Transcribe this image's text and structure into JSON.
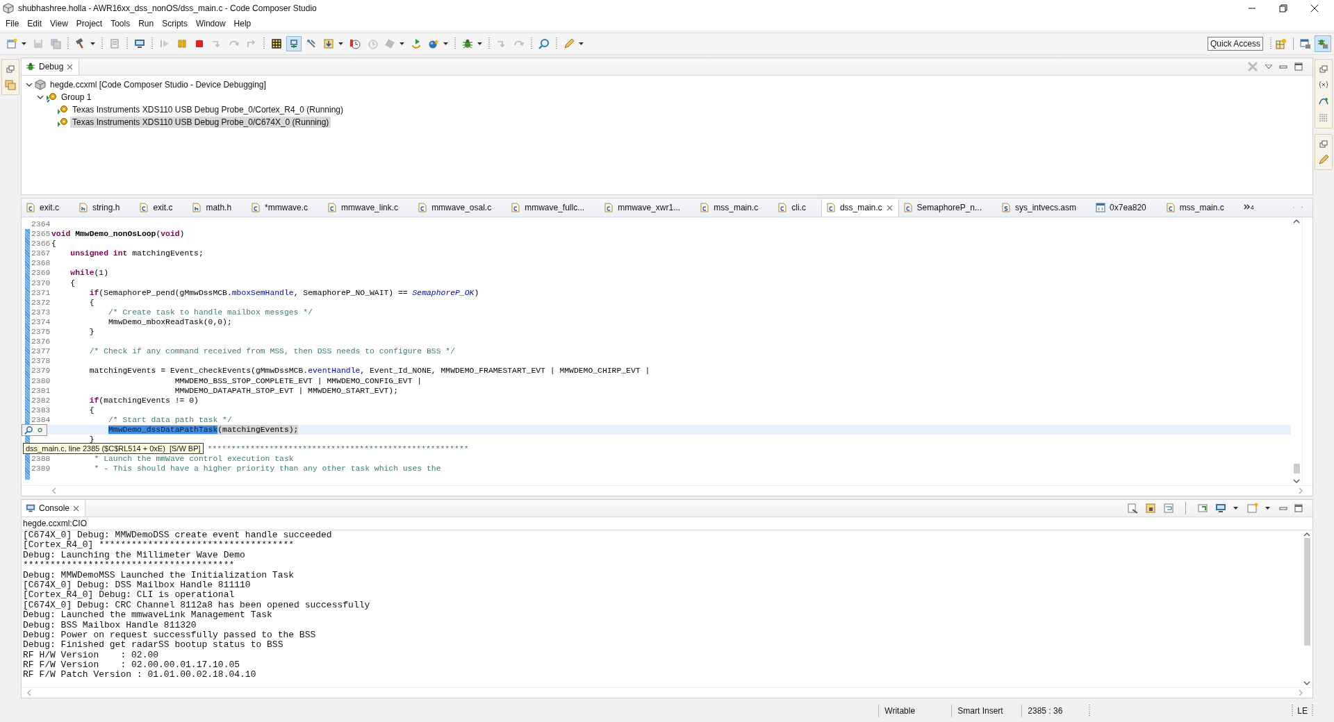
{
  "window": {
    "title": "shubhashree.holla - AWR16xx_dss_nonOS/dss_main.c - Code Composer Studio"
  },
  "menu": [
    "File",
    "Edit",
    "View",
    "Project",
    "Tools",
    "Run",
    "Scripts",
    "Window",
    "Help"
  ],
  "toolbar": {
    "quick_access": "Quick Access"
  },
  "debug_view": {
    "tab": "Debug",
    "tree": [
      {
        "label": "hegde.ccxml [Code Composer Studio - Device Debugging]",
        "kind": "config",
        "expanded": true,
        "selected": false,
        "children": [
          {
            "label": "Group 1",
            "kind": "group",
            "expanded": true,
            "selected": false,
            "children": [
              {
                "label": "Texas Instruments XDS110 USB Debug Probe_0/Cortex_R4_0 (Running)",
                "kind": "core",
                "selected": false
              },
              {
                "label": "Texas Instruments XDS110 USB Debug Probe_0/C674X_0 (Running)",
                "kind": "core",
                "selected": true
              }
            ]
          }
        ]
      }
    ]
  },
  "editor": {
    "tabs": [
      {
        "label": "exit.c",
        "kind": "source",
        "selected": false
      },
      {
        "label": "string.h",
        "kind": "header",
        "selected": false
      },
      {
        "label": "exit.c",
        "kind": "source",
        "selected": false
      },
      {
        "label": "math.h",
        "kind": "header",
        "selected": false
      },
      {
        "label": "*mmwave.c",
        "kind": "source",
        "selected": false
      },
      {
        "label": "mmwave_link.c",
        "kind": "source",
        "selected": false
      },
      {
        "label": "mmwave_osal.c",
        "kind": "source",
        "selected": false
      },
      {
        "label": "mmwave_fullc...",
        "kind": "source",
        "selected": false
      },
      {
        "label": "mmwave_xwr1...",
        "kind": "source",
        "selected": false
      },
      {
        "label": "mss_main.c",
        "kind": "source",
        "selected": false
      },
      {
        "label": "cli.c",
        "kind": "source",
        "selected": false
      },
      {
        "label": "dss_main.c",
        "kind": "source",
        "selected": true
      },
      {
        "label": "SemaphoreP_n...",
        "kind": "source",
        "selected": false
      },
      {
        "label": "sys_intvecs.asm",
        "kind": "assembly",
        "selected": false
      },
      {
        "label": "0x7ea820",
        "kind": "disassembly",
        "selected": false
      },
      {
        "label": "mss_main.c",
        "kind": "source",
        "selected": false
      }
    ],
    "overflow_count": "4",
    "lines": [
      {
        "number": "2364"
      },
      {
        "number": "2365",
        "segments": [
          {
            "kind": "keyword",
            "t": "void "
          },
          {
            "kind": "declaration",
            "t": "MmwDemo_nonOsLoop"
          },
          {
            "kind": "plain",
            "t": "("
          },
          {
            "kind": "keyword",
            "t": "void"
          },
          {
            "kind": "plain",
            "t": ")"
          }
        ]
      },
      {
        "number": "2366",
        "segments": [
          {
            "kind": "plain",
            "t": "{"
          }
        ]
      },
      {
        "number": "2367",
        "segments": [
          {
            "kind": "keyword",
            "t": "    unsigned int"
          },
          {
            "kind": "plain",
            "t": " matchingEvents;"
          }
        ]
      },
      {
        "number": "2368"
      },
      {
        "number": "2369",
        "segments": [
          {
            "kind": "keyword",
            "t": "    while"
          },
          {
            "kind": "plain",
            "t": "(1)"
          }
        ]
      },
      {
        "number": "2370",
        "segments": [
          {
            "kind": "plain",
            "t": "    {"
          }
        ]
      },
      {
        "number": "2371",
        "segments": [
          {
            "kind": "keyword",
            "t": "        if"
          },
          {
            "kind": "plain",
            "t": "(SemaphoreP_pend(gMmwDssMCB."
          },
          {
            "kind": "field",
            "t": "mboxSemHandle"
          },
          {
            "kind": "plain",
            "t": ", SemaphoreP_NO_WAIT) == "
          },
          {
            "kind": "constant",
            "t": "SemaphoreP_OK"
          },
          {
            "kind": "plain",
            "t": ")"
          }
        ]
      },
      {
        "number": "2372",
        "segments": [
          {
            "kind": "plain",
            "t": "        {"
          }
        ]
      },
      {
        "number": "2373",
        "segments": [
          {
            "kind": "comment",
            "t": "            /* Create task to handle mailbox messges */"
          }
        ]
      },
      {
        "number": "2374",
        "segments": [
          {
            "kind": "plain",
            "t": "            MmwDemo_mboxReadTask(0,0);"
          }
        ]
      },
      {
        "number": "2375",
        "segments": [
          {
            "kind": "plain",
            "t": "        }"
          }
        ]
      },
      {
        "number": "2376"
      },
      {
        "number": "2377",
        "segments": [
          {
            "kind": "comment",
            "t": "        /* Check if any command received from MSS, then DSS needs to configure BSS */"
          }
        ]
      },
      {
        "number": "2378"
      },
      {
        "number": "2379",
        "segments": [
          {
            "kind": "plain",
            "t": "        matchingEvents = Event_checkEvents(gMmwDssMCB."
          },
          {
            "kind": "field",
            "t": "eventHandle"
          },
          {
            "kind": "plain",
            "t": ", Event_Id_NONE, MMWDEMO_FRAMESTART_EVT | MMWDEMO_CHIRP_EVT |"
          }
        ]
      },
      {
        "number": "2380",
        "segments": [
          {
            "kind": "plain",
            "t": "                          MMWDEMO_BSS_STOP_COMPLETE_EVT | MMWDEMO_CONFIG_EVT |"
          }
        ]
      },
      {
        "number": "2381",
        "segments": [
          {
            "kind": "plain",
            "t": "                          MMWDEMO_DATAPATH_STOP_EVT | MMWDEMO_START_EVT);"
          }
        ]
      },
      {
        "number": "2382",
        "segments": [
          {
            "kind": "keyword",
            "t": "        if"
          },
          {
            "kind": "plain",
            "t": "(matchingEvents != 0)"
          }
        ]
      },
      {
        "number": "2383",
        "segments": [
          {
            "kind": "plain",
            "t": "        {"
          }
        ]
      },
      {
        "number": "2384",
        "segments": [
          {
            "kind": "comment",
            "t": "            /* Start data path task */"
          }
        ]
      },
      {
        "highlighted": true,
        "breakpoint": true,
        "segments": [
          {
            "kind": "selection",
            "t": "MmwDemo_dssDataPathTask"
          },
          {
            "kind": "plain",
            "t": "(matchingEvents);"
          }
        ]
      },
      {
        "segments": [
          {
            "kind": "plain",
            "t": "        }"
          }
        ]
      },
      {
        "tooltip": "dss_main.c, line 2385 ($C$RL514 + 0xE)  [S/W BP]",
        "segments": [
          {
            "kind": "comment",
            "t": "*******************************************************"
          }
        ]
      },
      {
        "number": "2388",
        "segments": [
          {
            "kind": "comment",
            "t": "         * Launch the mmWave control execution task"
          }
        ]
      },
      {
        "number": "2389",
        "segments": [
          {
            "kind": "comment",
            "t": "         * - This should have a higher priority than any other task which uses the"
          }
        ]
      }
    ]
  },
  "console": {
    "tab": "Console",
    "source": "hegde.ccxml:CIO",
    "lines": [
      "[C674X_0] Debug: MMWDemoDSS create event handle succeeded",
      "[Cortex_R4_0] ************************************",
      "Debug: Launching the Millimeter Wave Demo",
      "***************************************",
      "Debug: MMWDemoMSS Launched the Initialization Task",
      "[C674X_0] Debug: DSS Mailbox Handle 811110",
      "[Cortex_R4_0] Debug: CLI is operational",
      "[C674X_0] Debug: CRC Channel 8112a8 has been opened successfully",
      "Debug: Launched the mmwaveLink Management Task",
      "Debug: BSS Mailbox Handle 811320",
      "Debug: Power on request successfully passed to the BSS",
      "Debug: Finished get radarSS bootup status to BSS",
      "RF H/W Version    : 02.00",
      "RF F/W Version    : 02.00.00.01.17.10.05",
      "RF F/W Patch Version : 01.01.00.02.18.04.10"
    ]
  },
  "status_bar": {
    "mode": "Writable",
    "insert": "Smart Insert",
    "position": "2385 : 36",
    "line_ending": "LE"
  }
}
